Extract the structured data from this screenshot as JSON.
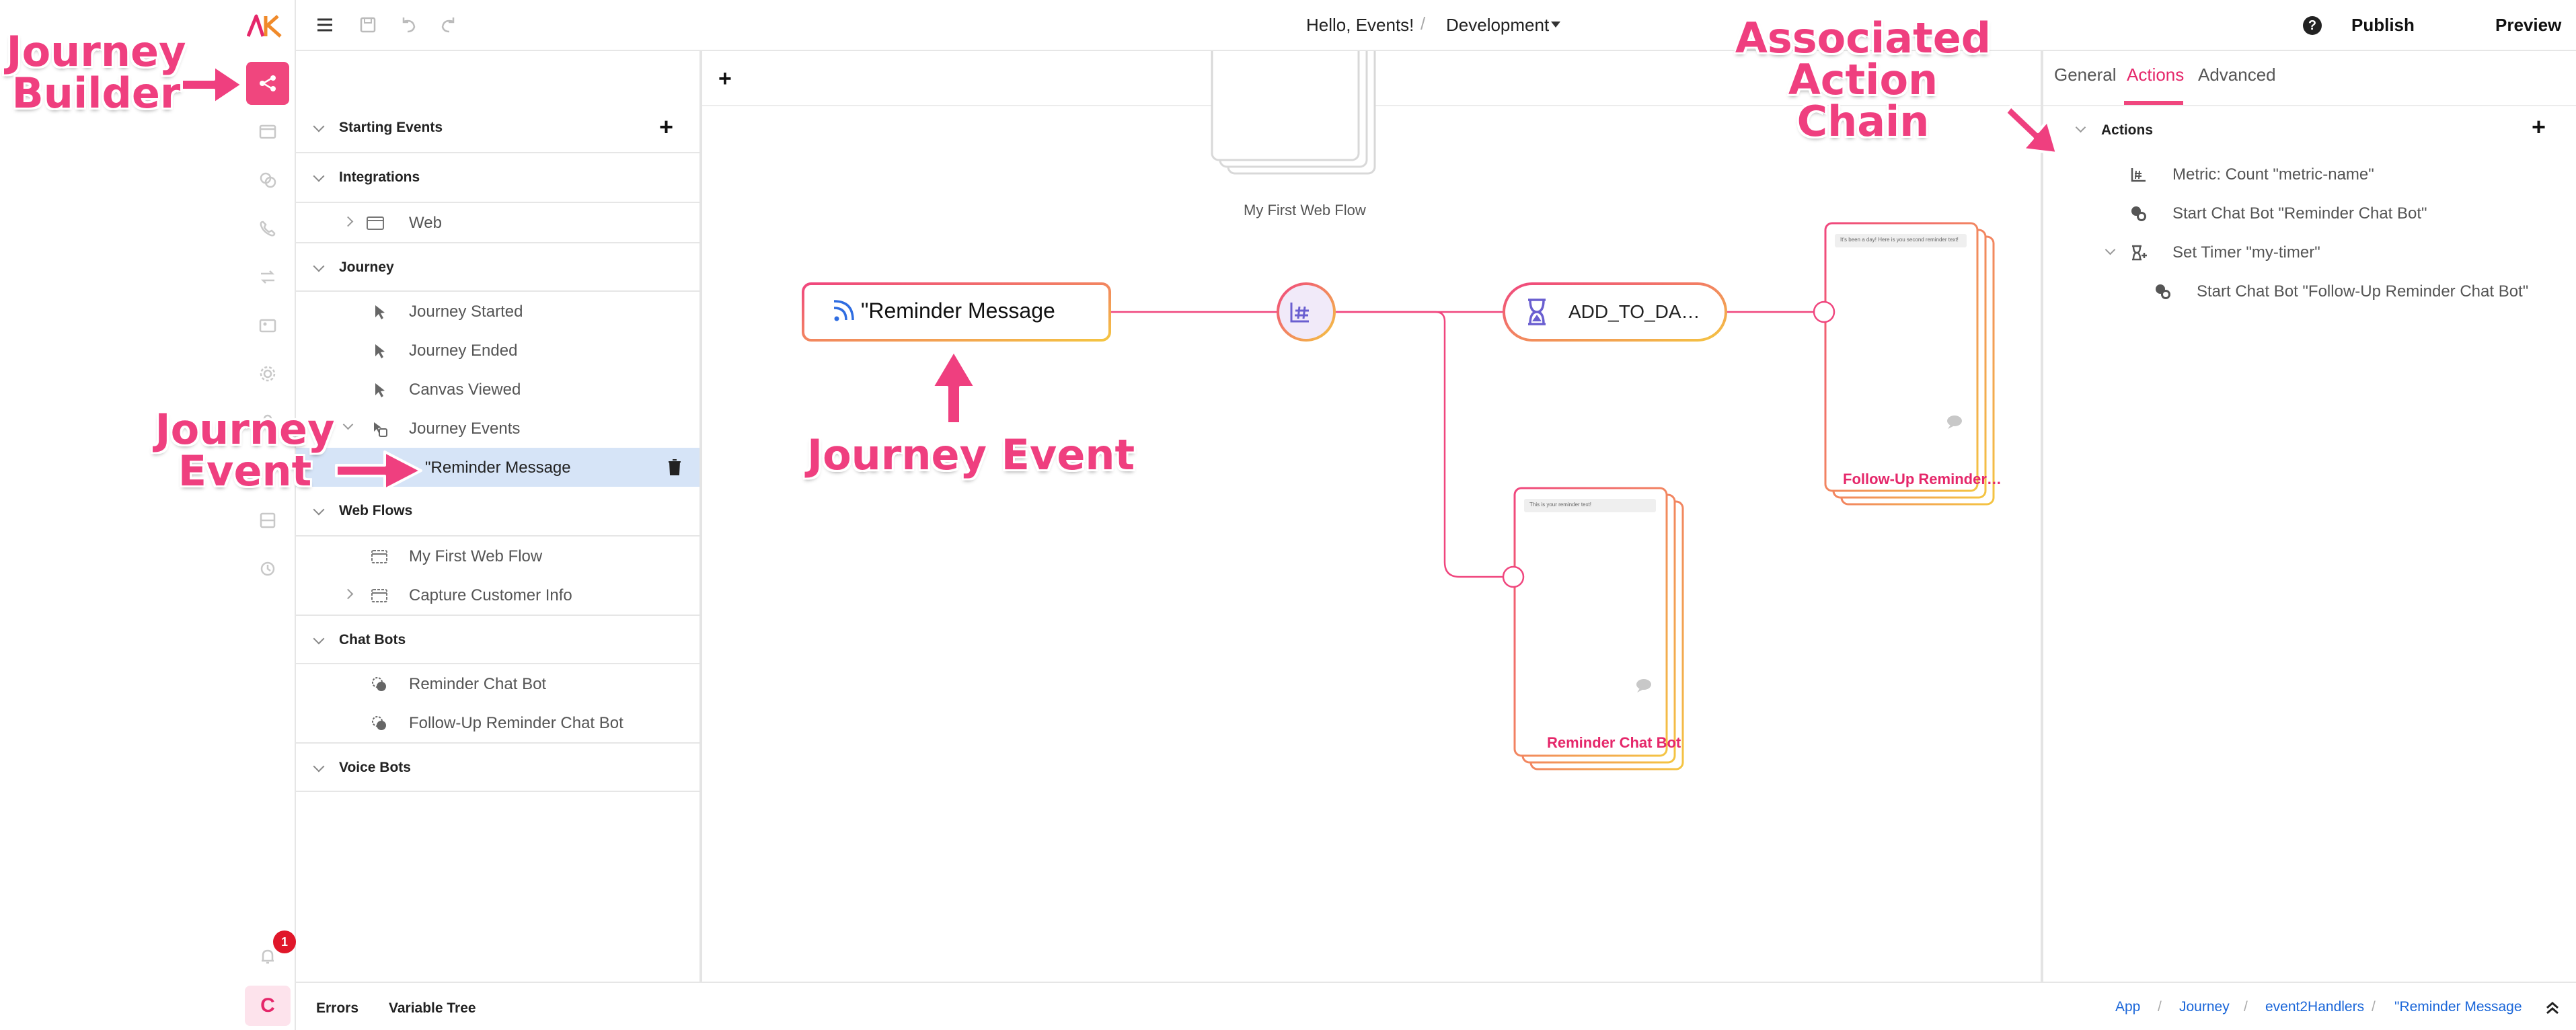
{
  "topbar": {
    "greeting": "Hello, Events!",
    "separator": "/",
    "environment": "Development",
    "publish_label": "Publish",
    "preview_label": "Preview",
    "help_label": "?"
  },
  "rail": {
    "logo": "AK",
    "notification_count": "1",
    "avatar_initial": "C",
    "items": [
      "journey-builder-icon",
      "web-flow-icon",
      "chat-bot-icon",
      "voice-bot-icon",
      "integration-icon",
      "media-icon",
      "settings-icon",
      "team-icon",
      "storage-icon",
      "history-icon"
    ]
  },
  "explorer": {
    "sections": {
      "starting_events": "Starting Events",
      "integrations": "Integrations",
      "journey": "Journey",
      "web_flows": "Web Flows",
      "chat_bots": "Chat Bots",
      "voice_bots": "Voice Bots"
    },
    "integrations": [
      "Web"
    ],
    "journey": [
      "Journey Started",
      "Journey Ended",
      "Canvas Viewed",
      "Journey Events"
    ],
    "journey_event_selected": "\"Reminder Message",
    "web_flows": [
      "My First Web Flow",
      "Capture Customer Info"
    ],
    "chat_bots": [
      "Reminder Chat Bot",
      "Follow-Up Reminder Chat Bot"
    ]
  },
  "canvas": {
    "web_flow_label": "My First Web Flow",
    "event_node_label": "\"Reminder Message",
    "data_node_label": "ADD_TO_DA…",
    "chatbot_label": "Reminder Chat Bot",
    "followup_label": "Follow-Up Reminder…",
    "chatbot_preview_text": "This is your reminder text!",
    "followup_preview_text": "It's been a day! Here is you second reminder text!"
  },
  "props": {
    "tabs": [
      "General",
      "Actions",
      "Advanced"
    ],
    "active_tab": "Actions",
    "actions_heading": "Actions",
    "actions": [
      "Metric: Count \"metric-name\"",
      "Start Chat Bot \"Reminder Chat Bot\"",
      "Set Timer \"my-timer\"",
      "Start Chat Bot \"Follow-Up Reminder Chat Bot\""
    ]
  },
  "bottombar": {
    "errors_label": "Errors",
    "variable_tree_label": "Variable Tree",
    "breadcrumb": [
      "App",
      "Journey",
      "event2Handlers",
      "\"Reminder Message"
    ]
  },
  "annotations": {
    "journey_builder": "Journey Builder",
    "journey_event_side": "Journey Event",
    "journey_event_canvas": "Journey Event",
    "associated_action_chain": "Associated Action Chain"
  },
  "colors": {
    "accent": "#f0467e",
    "accent_text": "#e5276a",
    "node_gradient_start": "#f0467e",
    "node_gradient_end": "#f4c542",
    "selected_row": "#d6e4f7",
    "link": "#1a66d9"
  }
}
